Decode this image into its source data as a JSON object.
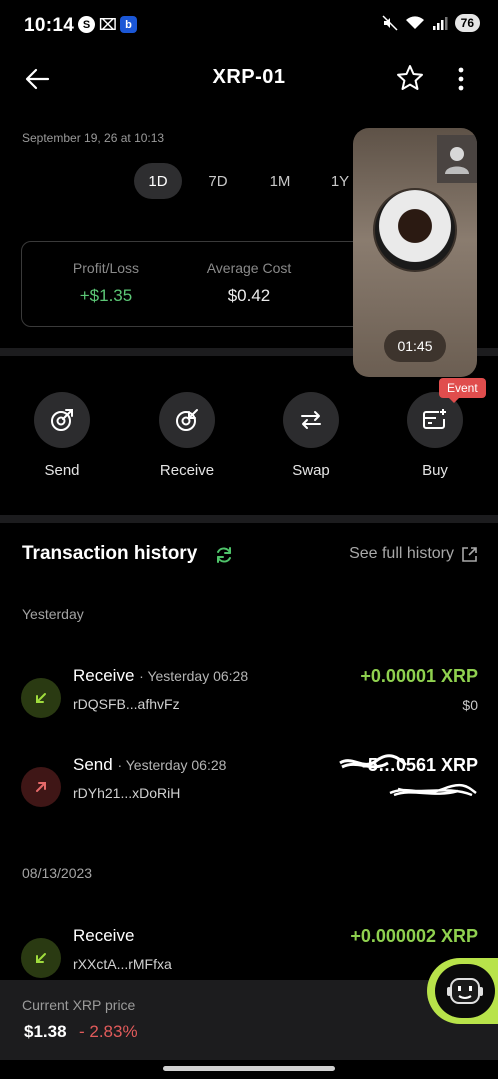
{
  "status_bar": {
    "time": "10:14",
    "battery": "76",
    "icons": [
      "s-icon",
      "capcut-icon",
      "b-app-icon",
      "mute-icon",
      "wifi-icon",
      "signal-icon"
    ]
  },
  "header": {
    "title": "XRP-01",
    "icons": [
      "back-arrow-icon",
      "star-icon",
      "more-vertical-icon"
    ]
  },
  "chart": {
    "timestamp": "September 19, 26 at 10:13",
    "ranges": [
      "1D",
      "7D",
      "1M",
      "1Y"
    ],
    "active_range": "1D"
  },
  "stats": {
    "profit_label": "Profit/Loss",
    "profit_value": "+$1.35",
    "avg_label": "Average Cost",
    "avg_value": "$0.42"
  },
  "video_pip": {
    "timer": "01:45"
  },
  "actions": [
    {
      "label": "Send",
      "icon": "send-icon"
    },
    {
      "label": "Receive",
      "icon": "receive-icon"
    },
    {
      "label": "Swap",
      "icon": "swap-icon"
    },
    {
      "label": "Buy",
      "icon": "buy-card-icon"
    }
  ],
  "event_badge": "Event",
  "history": {
    "title": "Transaction history",
    "see_full": "See full history",
    "groups": [
      {
        "date": "Yesterday",
        "items": [
          {
            "type": "Receive",
            "time": "· Yesterday 06:28",
            "address": "rDQSFB...afhvFz",
            "amount": "+0.00001 XRP",
            "fiat": "$0"
          },
          {
            "type": "Send",
            "time": "· Yesterday 06:28",
            "address": "rDYh21...xDoRiH",
            "amount": "-5…0561 XRP",
            "fiat": ""
          }
        ]
      },
      {
        "date": "08/13/2023",
        "items": [
          {
            "type": "Receive",
            "time": "",
            "address": "rXXctA...rMFfxa",
            "amount": "+0.000002 XRP",
            "fiat": ""
          }
        ]
      }
    ]
  },
  "price_bar": {
    "label": "Current XRP price",
    "price": "$1.38",
    "change": "- 2.83%"
  },
  "colors": {
    "positive": "#5cc776",
    "tx_positive": "#8fd14f",
    "negative": "#e15b5b",
    "event": "#e04d4d",
    "bot_accent": "#b8e34a"
  }
}
